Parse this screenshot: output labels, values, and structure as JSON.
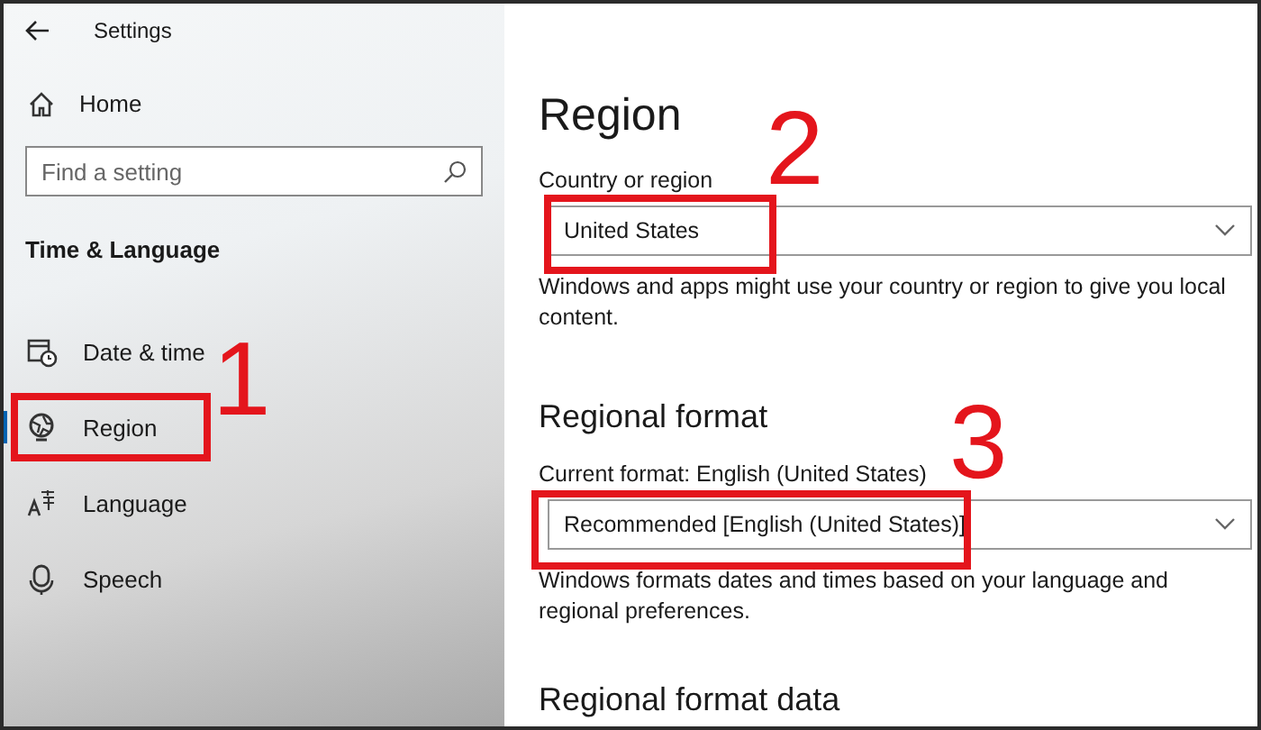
{
  "window": {
    "title": "Settings"
  },
  "sidebar": {
    "home": "Home",
    "search": {
      "placeholder": "Find a setting"
    },
    "section": "Time & Language",
    "items": [
      {
        "kind": "datetime",
        "label": "Date & time",
        "selected": false
      },
      {
        "kind": "region",
        "label": "Region",
        "selected": true,
        "callout": "1"
      },
      {
        "kind": "language",
        "label": "Language",
        "selected": false
      },
      {
        "kind": "speech",
        "label": "Speech",
        "selected": false
      }
    ]
  },
  "content": {
    "title": "Region",
    "country": {
      "label": "Country or region",
      "value": "United States",
      "callout": "2",
      "help": "Windows and apps might use your country or region to give you local content."
    },
    "format_heading": "Regional format",
    "format": {
      "label": "Current format: English (United States)",
      "value": "Recommended [English (United States)]",
      "callout": "3",
      "help": "Windows formats dates and times based on your language and regional preferences."
    },
    "data_heading": "Regional format data"
  }
}
